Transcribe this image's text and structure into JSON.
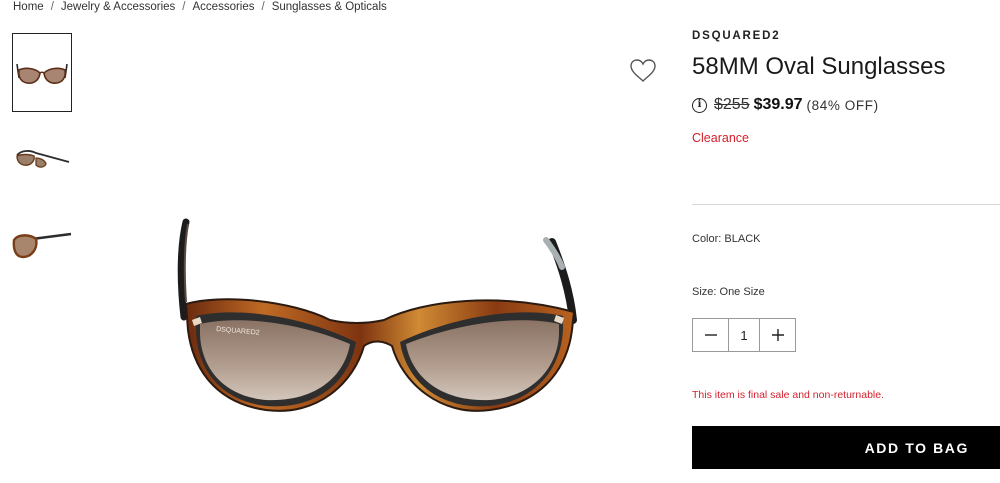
{
  "breadcrumb": {
    "items": [
      "Home",
      "Jewelry & Accessories",
      "Accessories",
      "Sunglasses & Opticals"
    ],
    "separator": "/"
  },
  "gallery": {
    "thumbnails": [
      {
        "view": "front",
        "active": true
      },
      {
        "view": "angle",
        "active": false
      },
      {
        "view": "side",
        "active": false
      }
    ],
    "wishlist_icon": "heart-icon"
  },
  "product": {
    "brand": "DSQUARED2",
    "title": "58MM Oval Sunglasses",
    "original_price": "$255",
    "sale_price": "$39.97",
    "discount": "(84% OFF)",
    "badge": "Clearance",
    "color_label": "Color: BLACK",
    "size_label": "Size: One Size",
    "quantity": "1",
    "final_sale_note": "This item is final sale and non-returnable.",
    "add_to_bag_label": "ADD TO BAG"
  },
  "colors": {
    "accent_red": "#d4202c",
    "button_black": "#000000"
  }
}
